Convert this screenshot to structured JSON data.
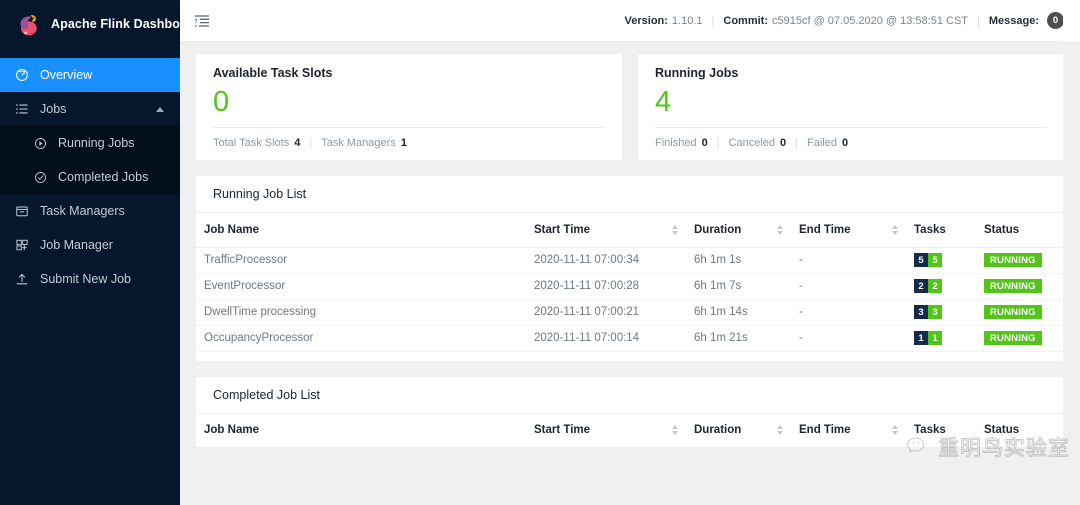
{
  "sidebar": {
    "brand": {
      "title": "Apache Flink Dashboard",
      "logo_icon": "flink-squirrel-logo"
    },
    "items": [
      {
        "label": "Overview",
        "icon": "dashboard-icon",
        "active": true
      },
      {
        "label": "Jobs",
        "icon": "list-icon",
        "expanded": true,
        "caret_icon": "chevron-up-icon"
      },
      {
        "label": "Running Jobs",
        "icon": "play-circle-icon",
        "sub": true
      },
      {
        "label": "Completed Jobs",
        "icon": "check-circle-icon",
        "sub": true
      },
      {
        "label": "Task Managers",
        "icon": "calendar-icon"
      },
      {
        "label": "Job Manager",
        "icon": "cluster-icon"
      },
      {
        "label": "Submit New Job",
        "icon": "upload-icon"
      }
    ]
  },
  "topbar": {
    "fold_icon": "menu-fold-icon",
    "version_label": "Version:",
    "version_value": "1.10.1",
    "commit_label": "Commit:",
    "commit_value": "c5915cf @ 07.05.2020 @ 13:58:51 CST",
    "message_label": "Message:",
    "message_count": "0",
    "separator": "|"
  },
  "cards": [
    {
      "title": "Available Task Slots",
      "big_value": "0",
      "accent": "#52c41a",
      "footer": [
        {
          "label": "Total Task Slots",
          "value": "4"
        },
        {
          "label": "Task Managers",
          "value": "1"
        }
      ]
    },
    {
      "title": "Running Jobs",
      "big_value": "4",
      "accent": "#52c41a",
      "footer": [
        {
          "label": "Finished",
          "value": "0"
        },
        {
          "label": "Canceled",
          "value": "0"
        },
        {
          "label": "Failed",
          "value": "0"
        }
      ]
    }
  ],
  "running_panel": {
    "title": "Running Job List",
    "columns": [
      {
        "label": "Job Name",
        "sortable": false
      },
      {
        "label": "Start Time",
        "sortable": true
      },
      {
        "label": "Duration",
        "sortable": true
      },
      {
        "label": "End Time",
        "sortable": true
      },
      {
        "label": "Tasks",
        "sortable": false
      },
      {
        "label": "Status",
        "sortable": true
      }
    ],
    "rows": [
      {
        "name": "TrafficProcessor",
        "start_time": "2020-11-11 07:00:34",
        "duration": "6h 1m 1s",
        "end_time": "-",
        "tasks_total": "5",
        "tasks_running": "5",
        "status": "RUNNING"
      },
      {
        "name": "EventProcessor",
        "start_time": "2020-11-11 07:00:28",
        "duration": "6h 1m 7s",
        "end_time": "-",
        "tasks_total": "2",
        "tasks_running": "2",
        "status": "RUNNING"
      },
      {
        "name": "DwellTime processing",
        "start_time": "2020-11-11 07:00:21",
        "duration": "6h 1m 14s",
        "end_time": "-",
        "tasks_total": "3",
        "tasks_running": "3",
        "status": "RUNNING"
      },
      {
        "name": "OccupancyProcessor",
        "start_time": "2020-11-11 07:00:14",
        "duration": "6h 1m 21s",
        "end_time": "-",
        "tasks_total": "1",
        "tasks_running": "1",
        "status": "RUNNING"
      }
    ]
  },
  "completed_panel": {
    "title": "Completed Job List",
    "columns": [
      {
        "label": "Job Name",
        "sortable": false
      },
      {
        "label": "Start Time",
        "sortable": true
      },
      {
        "label": "Duration",
        "sortable": true
      },
      {
        "label": "End Time",
        "sortable": true
      },
      {
        "label": "Tasks",
        "sortable": false
      },
      {
        "label": "Status",
        "sortable": true
      }
    ],
    "rows": []
  },
  "watermark": {
    "text": "重明鸟实验室",
    "icon": "wechat-icon"
  },
  "colors": {
    "sidebar_bg": "#06172c",
    "sidebar_sub_bg": "#020e1c",
    "active_blue": "#1890ff",
    "green": "#52c41a",
    "task_dark": "#122b4b",
    "page_bg": "#f0f0f0"
  }
}
